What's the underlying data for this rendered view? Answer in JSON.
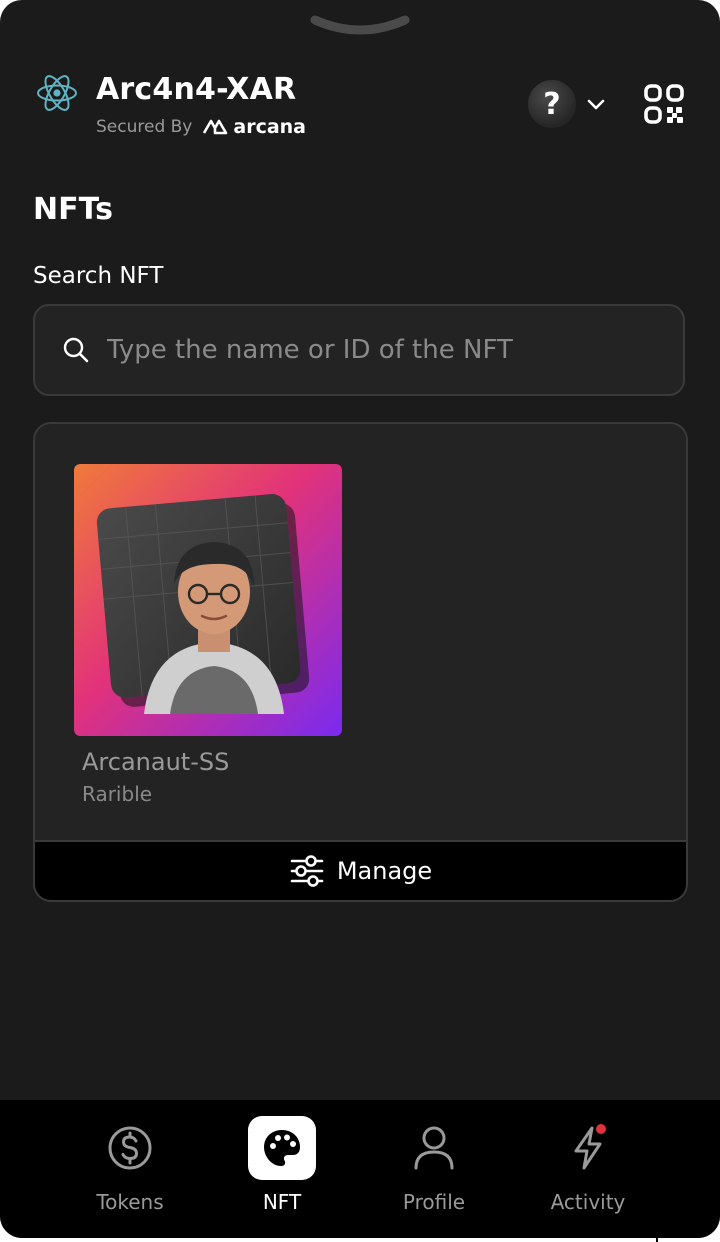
{
  "header": {
    "app_name": "Arc4n4-XAR",
    "secured_by": "Secured By",
    "brand": "arcana",
    "help_glyph": "?",
    "icons": [
      "react-logo-icon",
      "arcana-logo-icon",
      "chevron-down-icon",
      "qr-code-icon"
    ]
  },
  "page": {
    "title": "NFTs"
  },
  "search": {
    "label": "Search NFT",
    "placeholder": "Type the name or ID of the NFT",
    "value": ""
  },
  "nfts": [
    {
      "name": "Arcanaut-SS",
      "collection": "Rarible"
    }
  ],
  "manage": {
    "label": "Manage"
  },
  "bottom_nav": {
    "items": [
      {
        "label": "Tokens",
        "icon": "dollar-circle-icon",
        "active": false
      },
      {
        "label": "NFT",
        "icon": "palette-icon",
        "active": true
      },
      {
        "label": "Profile",
        "icon": "user-icon",
        "active": false
      },
      {
        "label": "Activity",
        "icon": "lightning-icon",
        "active": false,
        "notification": true
      }
    ]
  },
  "colors": {
    "background": "#1b1b1b",
    "panel": "#232323",
    "border": "#3a3a3a",
    "nav_background": "#000000",
    "notification": "#e0323e",
    "react_logo": "#5fb4c4"
  }
}
